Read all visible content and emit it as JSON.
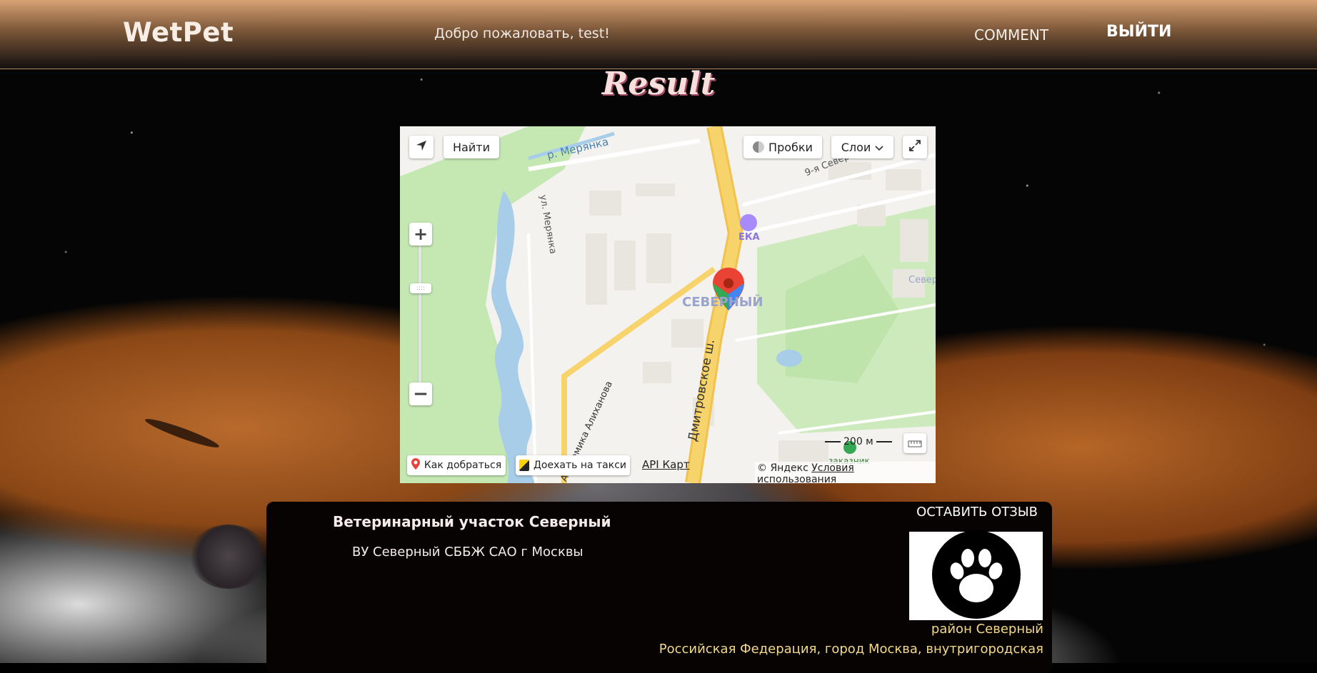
{
  "header": {
    "logo": "WetPet",
    "welcome": "Добро пожаловать, test!",
    "nav_comment": "COMMENT",
    "nav_logout": "ВЫЙТИ"
  },
  "page_title": "Result",
  "map": {
    "find_button": "Найти",
    "traffic_button": "Пробки",
    "layers_button": "Слои",
    "route_button": "Как добраться",
    "taxi_button": "Доехать на такси",
    "api_link": "API Карт",
    "scale": "200 м",
    "copyright_prefix": "© Яндекс",
    "terms_link": "Условия использования",
    "labels": {
      "river": "р. Мерянка",
      "street1": "ул. Мерянка",
      "street2": "9-я Северн",
      "street3": "Дмитровское ш.",
      "street4": "Академика Алиханова",
      "district": "СЕВЕРНЫЙ",
      "poi": "ЕКА",
      "area": "Север",
      "reserve": "заказник"
    },
    "colors": {
      "water": "#a8cde9",
      "park": "#c5e8b3",
      "road": "#f7d36c",
      "marker": "#e94335"
    }
  },
  "clinic": {
    "name": "Ветеринарный участок Северный",
    "subtitle": "ВУ Северный СББЖ САО г Москвы",
    "review_button": "ОСТАВИТЬ ОТЗЫВ",
    "district": "район Северный",
    "address": "Российская Федерация, город Москва, внутригородская"
  }
}
